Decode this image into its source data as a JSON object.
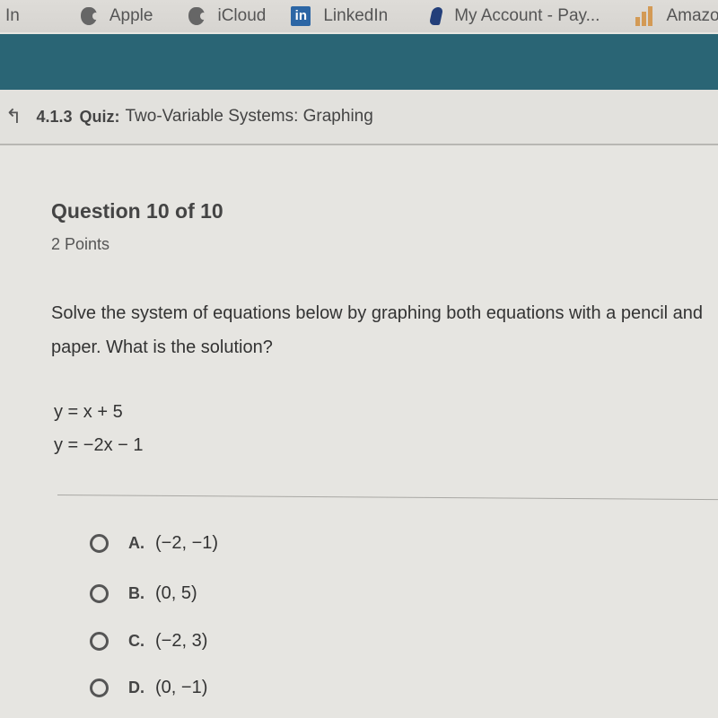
{
  "bookmarks": [
    {
      "icon": "linkedin-partial",
      "label": "In"
    },
    {
      "icon": "apple-icon",
      "label": "Apple"
    },
    {
      "icon": "apple-icon",
      "label": "iCloud"
    },
    {
      "icon": "linkedin-icon",
      "label": "LinkedIn"
    },
    {
      "icon": "paypal-icon",
      "label": "My Account - Pay..."
    },
    {
      "icon": "amazon-chart-icon",
      "label": "Amazon.com S"
    }
  ],
  "header": {
    "back_icon": "↰",
    "code": "4.1.3",
    "type": "Quiz:",
    "title": "Two-Variable Systems: Graphing"
  },
  "question": {
    "heading": "Question 10 of 10",
    "points": "2 Points",
    "prompt": "Solve the system of equations below by graphing both equations with a pencil and paper. What is the solution?",
    "equations": [
      "y = x + 5",
      "y = −2x − 1"
    ]
  },
  "options": [
    {
      "letter": "A.",
      "value": "(−2, −1)"
    },
    {
      "letter": "B.",
      "value": "(0, 5)"
    },
    {
      "letter": "C.",
      "value": "(−2, 3)"
    },
    {
      "letter": "D.",
      "value": "(0, −1)"
    }
  ],
  "colors": {
    "brand_bar": "#2a6575"
  }
}
